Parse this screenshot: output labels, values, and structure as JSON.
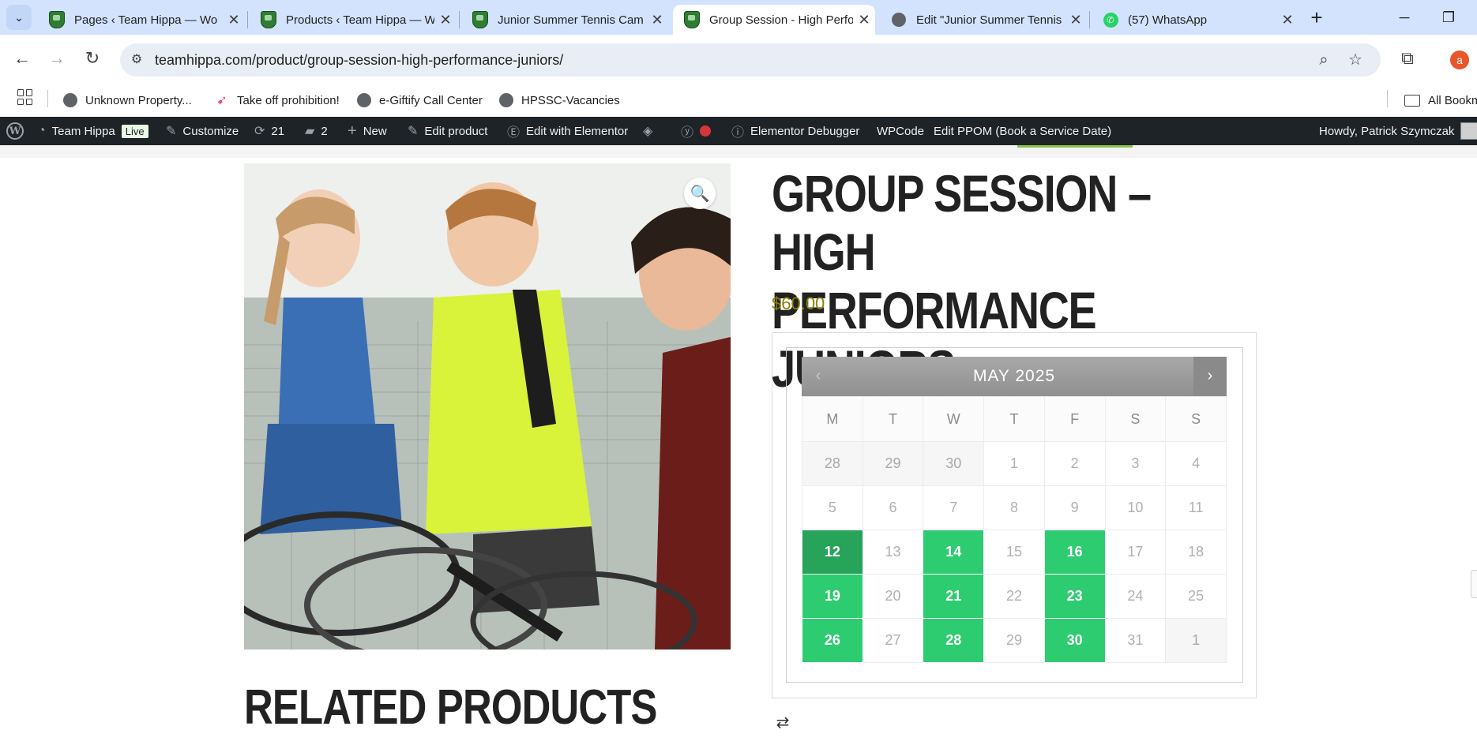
{
  "browser": {
    "tabs": [
      {
        "title": "Pages ‹ Team Hippa — Wo",
        "favicon": "team-hippa-shield",
        "active": false
      },
      {
        "title": "Products ‹ Team Hippa — W",
        "favicon": "team-hippa-shield",
        "active": false
      },
      {
        "title": "Junior Summer Tennis Cam",
        "favicon": "team-hippa-shield",
        "active": false
      },
      {
        "title": "Group Session - High Perfo",
        "favicon": "team-hippa-shield",
        "active": true
      },
      {
        "title": "Edit \"Junior Summer Tennis",
        "favicon": "globe",
        "active": false
      },
      {
        "title": "(57) WhatsApp",
        "favicon": "whatsapp",
        "active": false
      }
    ],
    "url_host": "teamhippa.com",
    "url_path": "/product/group-session-high-performance-juniors/",
    "profile_initial": "a",
    "bookmarks": [
      {
        "label": "Unknown Property...",
        "icon": "globe-icon"
      },
      {
        "label": "Take off prohibition!",
        "icon": "bird-icon"
      },
      {
        "label": "e-Giftify Call Center",
        "icon": "globe-icon"
      },
      {
        "label": "HPSSC-Vacancies",
        "icon": "globe-icon"
      }
    ],
    "all_bookmarks_label": "All Bookm"
  },
  "wp_admin_bar": {
    "site_name": "Team Hippa",
    "live_badge": "Live",
    "customize": "Customize",
    "updates_count": "21",
    "comments_count": "2",
    "new": "New",
    "edit_product": "Edit product",
    "edit_elementor": "Edit with Elementor",
    "elementor_debugger": "Elementor Debugger",
    "wpcode": "WPCode",
    "edit_ppom": "Edit PPOM (Book a Service Date)",
    "howdy": "Howdy, Patrick Szymczak"
  },
  "product": {
    "title_line1": "GROUP SESSION – HIGH",
    "title_line2": "PERFORMANCE JUNIORS",
    "price": "$60.00",
    "related_heading": "RELATED PRODUCTS"
  },
  "calendar": {
    "month_label": "MAY 2025",
    "prev": "‹",
    "next": "›",
    "weekdays": [
      "M",
      "T",
      "W",
      "T",
      "F",
      "S",
      "S"
    ],
    "weeks": [
      [
        {
          "d": "28",
          "s": "other"
        },
        {
          "d": "29",
          "s": "other"
        },
        {
          "d": "30",
          "s": "other"
        },
        {
          "d": "1",
          "s": "day"
        },
        {
          "d": "2",
          "s": "day"
        },
        {
          "d": "3",
          "s": "day"
        },
        {
          "d": "4",
          "s": "day"
        }
      ],
      [
        {
          "d": "5",
          "s": "day"
        },
        {
          "d": "6",
          "s": "day"
        },
        {
          "d": "7",
          "s": "day"
        },
        {
          "d": "8",
          "s": "day"
        },
        {
          "d": "9",
          "s": "day"
        },
        {
          "d": "10",
          "s": "day"
        },
        {
          "d": "11",
          "s": "day"
        }
      ],
      [
        {
          "d": "12",
          "s": "selected"
        },
        {
          "d": "13",
          "s": "day"
        },
        {
          "d": "14",
          "s": "avail"
        },
        {
          "d": "15",
          "s": "day"
        },
        {
          "d": "16",
          "s": "avail"
        },
        {
          "d": "17",
          "s": "day"
        },
        {
          "d": "18",
          "s": "day"
        }
      ],
      [
        {
          "d": "19",
          "s": "avail"
        },
        {
          "d": "20",
          "s": "day"
        },
        {
          "d": "21",
          "s": "avail"
        },
        {
          "d": "22",
          "s": "day"
        },
        {
          "d": "23",
          "s": "avail"
        },
        {
          "d": "24",
          "s": "day"
        },
        {
          "d": "25",
          "s": "day"
        }
      ],
      [
        {
          "d": "26",
          "s": "avail"
        },
        {
          "d": "27",
          "s": "day"
        },
        {
          "d": "28",
          "s": "avail"
        },
        {
          "d": "29",
          "s": "day"
        },
        {
          "d": "30",
          "s": "avail"
        },
        {
          "d": "31",
          "s": "day"
        },
        {
          "d": "1",
          "s": "other"
        }
      ]
    ]
  },
  "colors": {
    "available_day": "#2ecc71",
    "selected_day": "#27a35a",
    "price": "#8a8200",
    "wp_bar": "#1d2327",
    "tab_strip": "#d3e3fd"
  }
}
